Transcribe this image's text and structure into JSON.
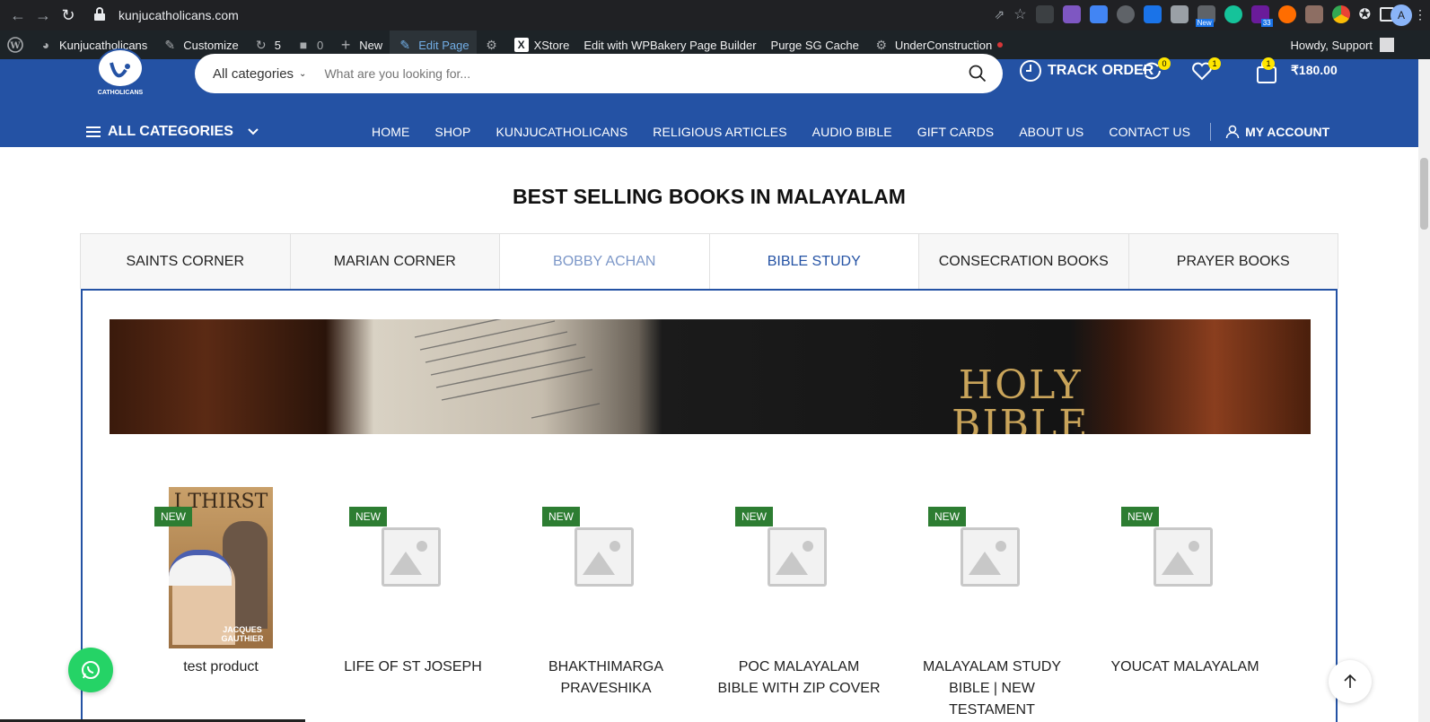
{
  "browser": {
    "url": "kunjucatholicans.com",
    "avatar_letter": "A",
    "ext_new_badge": "New",
    "ext_count_badge": "33"
  },
  "admin_bar": {
    "site_name": "Kunjucatholicans",
    "customize": "Customize",
    "updates_count": "5",
    "comments_count": "0",
    "new_label": "New",
    "edit_page": "Edit Page",
    "xstore": "XStore",
    "wpbakery": "Edit with WPBakery Page Builder",
    "purge": "Purge SG Cache",
    "under_construction": "UnderConstruction",
    "howdy": "Howdy, Support"
  },
  "header": {
    "logo_text": "CATHOLICANS",
    "category_select": "All categories",
    "search_placeholder": "What are you looking for...",
    "track_order": "TRACK ORDER",
    "compare_count": "0",
    "wishlist_count": "1",
    "cart_count": "1",
    "cart_total": "₹180.00",
    "colors": {
      "primary": "#2452a4",
      "badge": "#ffe600"
    }
  },
  "nav": {
    "all_categories": "ALL CATEGORIES",
    "items": [
      "HOME",
      "SHOP",
      "KUNJUCATHOLICANS",
      "RELIGIOUS ARTICLES",
      "AUDIO BIBLE",
      "GIFT CARDS",
      "ABOUT US",
      "CONTACT US"
    ],
    "account": "MY ACCOUNT"
  },
  "section": {
    "title": "BEST SELLING BOOKS IN MALAYALAM",
    "tabs": [
      "SAINTS CORNER",
      "MARIAN CORNER",
      "BOBBY ACHAN",
      "BIBLE STUDY",
      "CONSECRATION BOOKS",
      "PRAYER BOOKS"
    ],
    "active_tab": "BIBLE STUDY",
    "banner_text_line1": "HOLY",
    "banner_text_line2": "BIBLE"
  },
  "products": [
    {
      "badge": "NEW",
      "title": "test product",
      "cover_title": "I THIRST",
      "cover_author": "JACQUES GAUTHIER"
    },
    {
      "badge": "NEW",
      "title": "LIFE OF ST JOSEPH"
    },
    {
      "badge": "NEW",
      "title": "BHAKTHIMARGA PRAVESHIKA"
    },
    {
      "badge": "NEW",
      "title": "POC MALAYALAM BIBLE WITH ZIP COVER"
    },
    {
      "badge": "NEW",
      "title": "MALAYALAM STUDY BIBLE | NEW TESTAMENT"
    },
    {
      "badge": "NEW",
      "title": "YOUCAT MALAYALAM"
    }
  ]
}
